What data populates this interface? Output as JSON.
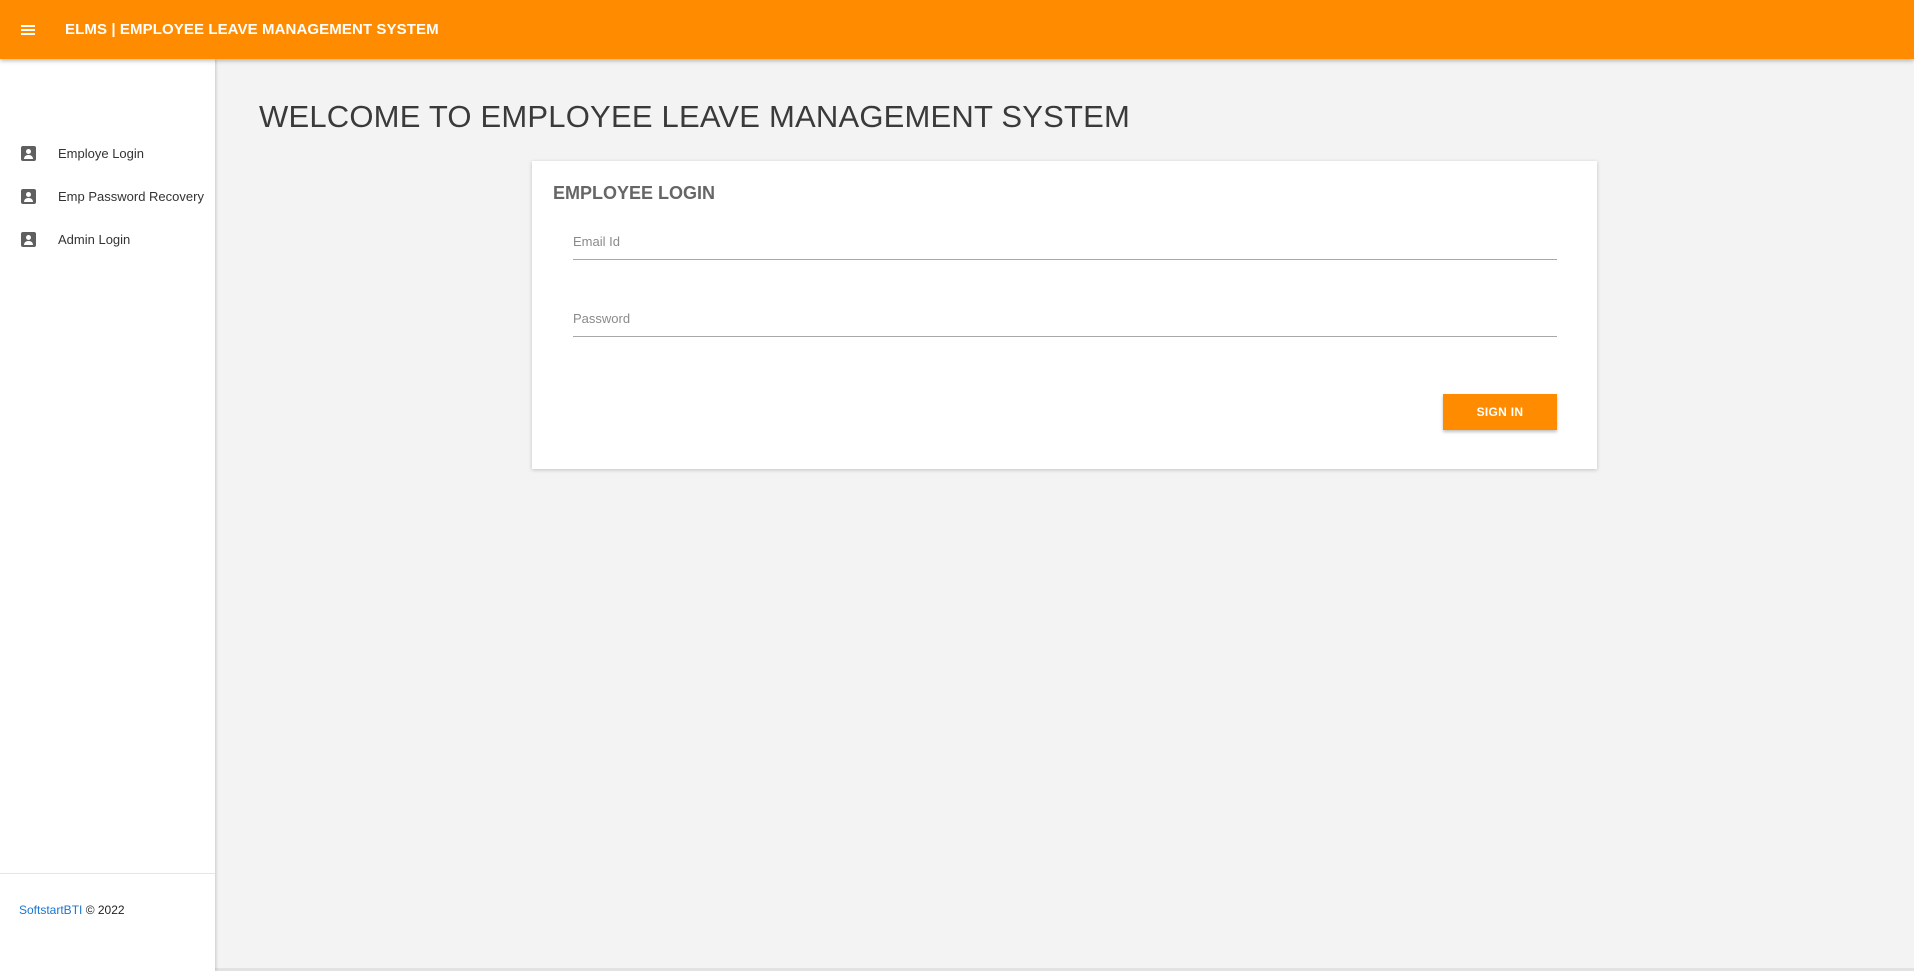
{
  "header": {
    "title": "ELMS | EMPLOYEE LEAVE MANAGEMENT SYSTEM",
    "menu_icon": "hamburger-menu-icon"
  },
  "sidebar": {
    "items": [
      {
        "label": "Employe Login",
        "icon": "account-box-icon"
      },
      {
        "label": "Emp Password Recovery",
        "icon": "account-box-icon"
      },
      {
        "label": "Admin Login",
        "icon": "account-box-icon"
      }
    ],
    "footer": {
      "link": "SoftstartBTI",
      "text": " © 2022"
    }
  },
  "main": {
    "welcome": "WELCOME TO EMPLOYEE LEAVE MANAGEMENT SYSTEM",
    "login_card": {
      "title": "EMPLOYEE LOGIN",
      "email_placeholder": "Email Id",
      "password_placeholder": "Password",
      "submit_label": "SIGN IN"
    }
  },
  "colors": {
    "accent": "#ff8c00",
    "link": "#1976d2",
    "background": "#f3f3f3"
  }
}
